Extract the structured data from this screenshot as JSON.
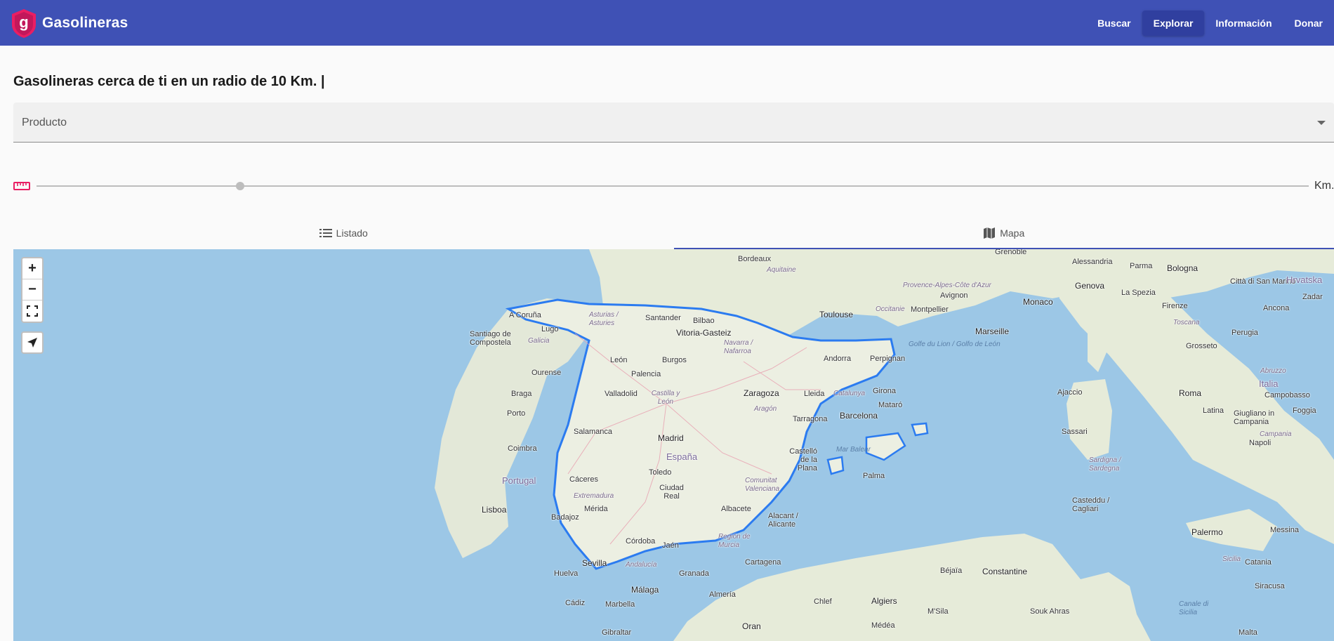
{
  "app": {
    "name": "Gasolineras",
    "logo_letter": "g"
  },
  "nav": {
    "items": [
      {
        "label": "Buscar",
        "active": false
      },
      {
        "label": "Explorar",
        "active": true
      },
      {
        "label": "Información",
        "active": false
      },
      {
        "label": "Donar",
        "active": false
      }
    ]
  },
  "heading": "Gasolineras cerca de ti en un radio de 10 Km. |",
  "product_select": {
    "label": "Producto"
  },
  "radius_slider": {
    "unit": "Km.",
    "value_fraction": 0.16
  },
  "tabs": [
    {
      "label": "Listado",
      "icon": "list-icon",
      "active": false
    },
    {
      "label": "Mapa",
      "icon": "map-icon",
      "active": true
    }
  ],
  "map": {
    "controls": {
      "zoom_in": "+",
      "zoom_out": "−"
    },
    "labels": {
      "bordeaux": "Bordeaux",
      "aquitaine": "Aquitaine",
      "grenoble": "Grenoble",
      "alessandria": "Alessandria",
      "parma": "Parma",
      "bologna": "Bologna",
      "san_marino": "Città di San Marino",
      "hrvatska": "Hrvatska",
      "zadar": "Zadar",
      "genova": "Genova",
      "la_spezia": "La Spezia",
      "firenze": "Firenze",
      "ancona": "Ancona",
      "provence": "Provence-Alpes-Côte d'Azur",
      "avignon": "Avignon",
      "monaco": "Monaco",
      "toulouse": "Toulouse",
      "occitanie": "Occitanie",
      "montpellier": "Montpellier",
      "marseille": "Marseille",
      "toscana": "Toscana",
      "perugia": "Perugia",
      "golfe": "Golfe du Lion / Golfo de León",
      "grosseto": "Grosseto",
      "italia": "Italia",
      "abruzzo": "Abruzzo",
      "a_coruna": "A Coruña",
      "santiago": "Santiago de Compostela",
      "lugo": "Lugo",
      "galicia": "Galicia",
      "asturias": "Asturias / Asturies",
      "santander": "Santander",
      "bilbao": "Bilbao",
      "vitoria": "Vitoria-Gasteiz",
      "navarra": "Navarra / Nafarroa",
      "andorra": "Andorra",
      "perpignan": "Perpignan",
      "ourense": "Ourense",
      "leon": "León",
      "burgos": "Burgos",
      "palencia": "Palencia",
      "castilla_leon": "Castilla y León",
      "valladolid": "Valladolid",
      "zaragoza": "Zaragoza",
      "lleida": "Lleida",
      "catalunya": "Catalunya",
      "girona": "Girona",
      "ajaccio": "Ajaccio",
      "roma": "Roma",
      "campobasso": "Campobasso",
      "braga": "Braga",
      "porto": "Porto",
      "aragon": "Aragón",
      "mataro": "Mataró",
      "tarragona": "Tarragona",
      "barcelona": "Barcelona",
      "latina": "Latina",
      "giugliano": "Giugliano in Campania",
      "foggia": "Foggia",
      "campania": "Campania",
      "salamanca": "Salamanca",
      "madrid": "Madrid",
      "sassari": "Sassari",
      "napoli": "Napoli",
      "coimbra": "Coimbra",
      "espana": "España",
      "castello": "Castelló de la Plana",
      "mar_balear": "Mar Balear",
      "sardegna": "Sardigna / Sardegna",
      "portugal": "Portugal",
      "caceres": "Cáceres",
      "toledo": "Toledo",
      "comunitat": "Comunitat Valenciana",
      "palma": "Palma",
      "extremadura": "Extremadura",
      "ciudad_real": "Ciudad Real",
      "lisboa": "Lisboa",
      "merida": "Mérida",
      "albacete": "Albacete",
      "casteddu": "Casteddu / Cagliari",
      "badajoz": "Badajoz",
      "alacant": "Alacant / Alicante",
      "region_murcia": "Región de Murcia",
      "palermo": "Palermo",
      "messina": "Messina",
      "cordoba": "Córdoba",
      "jaen": "Jaén",
      "cartagena": "Cartagena",
      "sevilla": "Sevilla",
      "andalucia": "Andalucía",
      "granada": "Granada",
      "huelva": "Huelva",
      "bejaia": "Béjaïa",
      "constantine": "Constantine",
      "catania": "Catania",
      "sicilia": "Sicilia",
      "siracusa": "Siracusa",
      "malaga": "Málaga",
      "almeria": "Almería",
      "cadiz": "Cádiz",
      "marbella": "Marbella",
      "chlef": "Chlef",
      "algiers": "Algiers",
      "msila": "M'Sila",
      "souk_ahras": "Souk Ahras",
      "canale": "Canale di Sicilia",
      "gibraltar": "Gibraltar",
      "oran": "Oran",
      "medea": "Médéa",
      "malta": "Malta"
    }
  },
  "colors": {
    "primary": "#3f51b5",
    "primary_dark": "#303f9f",
    "accent": "#e91e63",
    "sea": "#9cc7e6",
    "land": "#e8ece0",
    "spain_border": "#2b7bf0"
  }
}
